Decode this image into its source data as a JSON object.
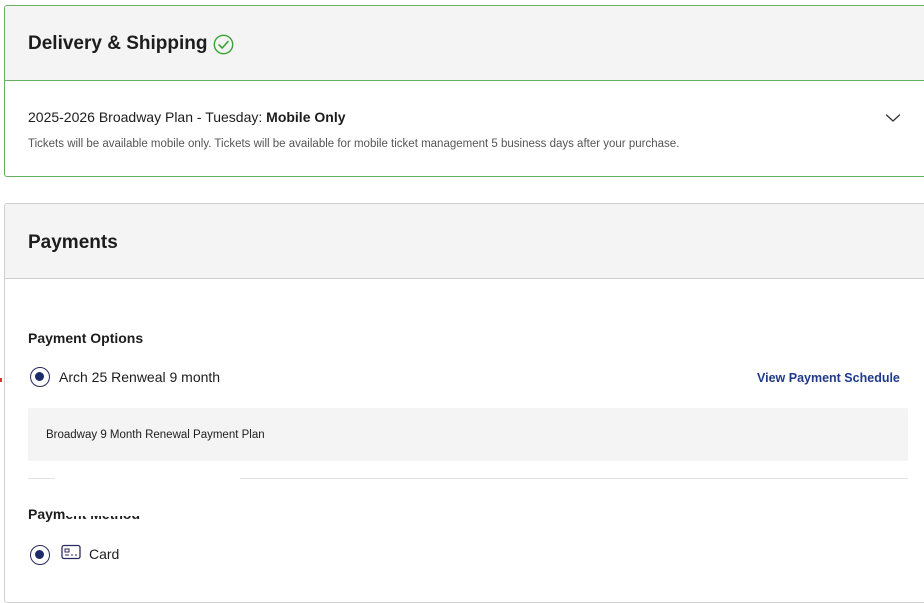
{
  "delivery": {
    "title": "Delivery & Shipping",
    "status_icon": "check-circle-icon",
    "accent_color": "#66b35f",
    "plan_prefix": "2025-2026 Broadway Plan - Tuesday: ",
    "plan_method": "Mobile Only",
    "note": "Tickets will be available mobile only. Tickets will be available for mobile ticket management 5 business days after your purchase.",
    "expand_icon": "chevron-down-icon"
  },
  "payments": {
    "title": "Payments",
    "options_label": "Payment Options",
    "option_label": "Arch 25 Renweal 9 month",
    "option_selected": true,
    "schedule_link": "View Payment Schedule",
    "plan_description": "Broadway 9 Month Renewal Payment Plan",
    "method_label": "Payment Method",
    "method_option": "Card",
    "method_icon": "credit-card-icon",
    "radio_color": "#1f2a6b",
    "link_color": "#1f3a8a"
  }
}
